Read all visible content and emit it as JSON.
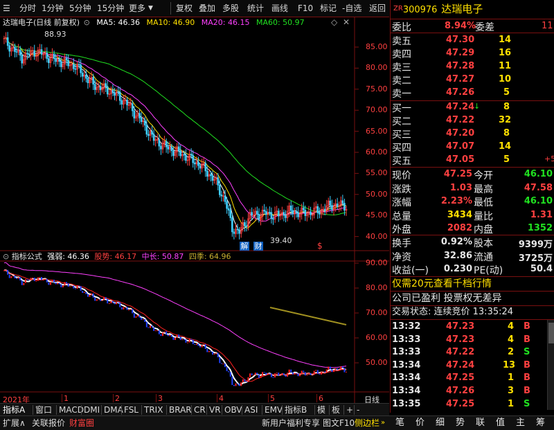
{
  "toolbar": {
    "items": [
      "分时",
      "1分钟",
      "5分钟",
      "15分钟",
      "更多",
      "复权",
      "叠加",
      "多股",
      "统计",
      "画线",
      "F10",
      "标记",
      "-自选",
      "返回"
    ]
  },
  "chart_title": {
    "stock": "达瑞电子",
    "mode": "(日线 前复权)",
    "ma5": "MA5: 46.36",
    "ma10": "MA10: 46.90",
    "ma20": "MA20: 46.15",
    "ma60": "MA60: 50.97"
  },
  "main_axis": {
    "ticks": [
      "85.00",
      "80.00",
      "75.00",
      "70.00",
      "65.00",
      "60.00",
      "55.00",
      "50.00",
      "45.00",
      "40.00"
    ]
  },
  "annotations": {
    "high": "88.93",
    "low": "39.40",
    "jie": "解",
    "cai": "财",
    "dollar": "$"
  },
  "indicator_title": {
    "name": "指标公式",
    "v1": "强弱: 46.36",
    "v2": "股势: 46.17",
    "v3": "中长: 50.87",
    "v4": "四季: 64.96"
  },
  "sub_axis": {
    "ticks": [
      "90.00",
      "80.00",
      "70.00",
      "60.00",
      "50.00"
    ]
  },
  "time_axis": {
    "labels": [
      "2021年",
      "1",
      "2",
      "3",
      "4",
      "5",
      "6"
    ],
    "period": "日线"
  },
  "tabs": [
    "指标A",
    "窗口",
    "MACD",
    "DMI",
    "DMA",
    "FSL",
    "TRIX",
    "BRAR",
    "CR",
    "VR",
    "OBV",
    "ASI",
    "EMV",
    "指标B",
    "模",
    "板",
    "+",
    "-"
  ],
  "status": {
    "expand": "扩展∧",
    "link": "关联报价",
    "rich": "财富圈",
    "news": "新用户福利专享",
    "f10": "图文F10",
    "sidebar": "侧边栏",
    "right_tabs": [
      "笔",
      "价",
      "细",
      "势",
      "联",
      "值",
      "主",
      "筹"
    ]
  },
  "quote": {
    "code_prefix": "ZR",
    "code": "300976",
    "name": "达瑞电子",
    "weibi_label": "委比",
    "weibi": "8.94%",
    "weicha_label": "委差",
    "weicha": "11",
    "asks": [
      {
        "label": "卖五",
        "price": "47.30",
        "vol": "14"
      },
      {
        "label": "卖四",
        "price": "47.29",
        "vol": "16"
      },
      {
        "label": "卖三",
        "price": "47.28",
        "vol": "11"
      },
      {
        "label": "卖二",
        "price": "47.27",
        "vol": "10"
      },
      {
        "label": "卖一",
        "price": "47.26",
        "vol": "5"
      }
    ],
    "bids": [
      {
        "label": "买一",
        "price": "47.24",
        "vol": "8",
        "extra": "↓"
      },
      {
        "label": "买二",
        "price": "47.22",
        "vol": "32",
        "extra": ""
      },
      {
        "label": "买三",
        "price": "47.20",
        "vol": "8",
        "extra": ""
      },
      {
        "label": "买四",
        "price": "47.07",
        "vol": "14",
        "extra": ""
      },
      {
        "label": "买五",
        "price": "47.05",
        "vol": "5",
        "extra": "+5"
      }
    ],
    "stats": [
      {
        "l1": "现价",
        "v1": "47.25",
        "l2": "今开",
        "v2": "46.10"
      },
      {
        "l1": "涨跌",
        "v1": "1.03",
        "l2": "最高",
        "v2": "47.58"
      },
      {
        "l1": "涨幅",
        "v1": "2.23%",
        "l2": "最低",
        "v2": "46.10"
      },
      {
        "l1": "总量",
        "v1": "3434",
        "l2": "量比",
        "v2": "1.31"
      },
      {
        "l1": "外盘",
        "v1": "2082",
        "l2": "内盘",
        "v2": "1352"
      }
    ],
    "stats2": [
      {
        "l1": "换手",
        "v1": "0.92%",
        "l2": "股本",
        "v2": "9399万"
      },
      {
        "l1": "净资",
        "v1": "32.86",
        "l2": "流通",
        "v2": "3725万"
      },
      {
        "l1": "收益(一)",
        "v1": "0.230",
        "l2": "PE(动)",
        "v2": "50.4"
      }
    ],
    "promo": "仅需20元查看千档行情",
    "info": "公司已盈利 投票权无差异",
    "trade_state": "交易状态: 连续竞价 13:35:24",
    "ticks": [
      {
        "t": "13:32",
        "p": "47.23",
        "v": "4",
        "d": "B"
      },
      {
        "t": "13:33",
        "p": "47.23",
        "v": "4",
        "d": "B"
      },
      {
        "t": "13:33",
        "p": "47.22",
        "v": "2",
        "d": "S"
      },
      {
        "t": "13:34",
        "p": "47.24",
        "v": "13",
        "d": "B"
      },
      {
        "t": "13:34",
        "p": "47.25",
        "v": "1",
        "d": "B"
      },
      {
        "t": "13:34",
        "p": "47.26",
        "v": "3",
        "d": "B"
      },
      {
        "t": "13:35",
        "p": "47.25",
        "v": "1",
        "d": "S"
      }
    ]
  },
  "colors": {
    "up": "#ff4040",
    "down": "#20e020",
    "ma5": "#ffffff",
    "ma10": "#ffe000",
    "ma20": "#ff40ff",
    "ma60": "#20e020",
    "accent": "#7a1010"
  }
}
